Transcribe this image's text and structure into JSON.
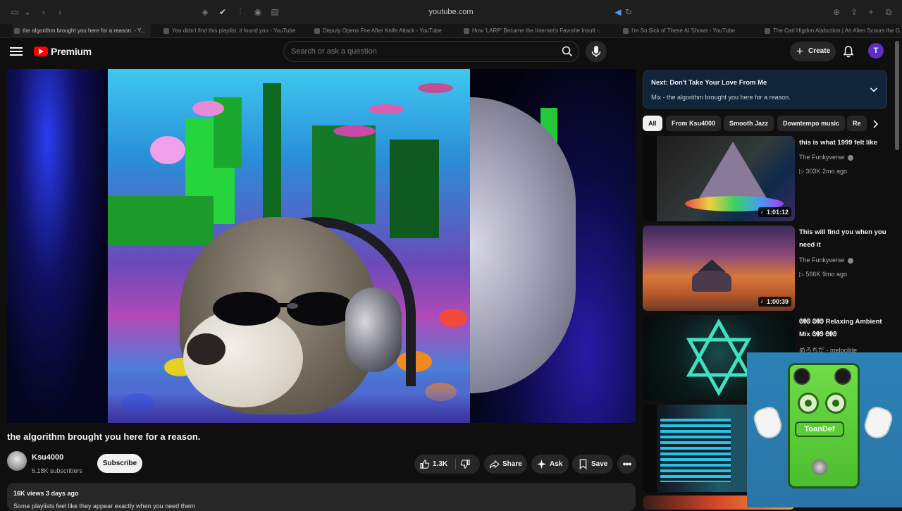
{
  "browser": {
    "url": "youtube.com",
    "tabs": [
      "the algorithm brought you here for a reason. - Y...",
      "You didn't find this playlist, it found you - YouTube",
      "Deputy Opens Fire After Knife Attack - YouTube",
      "How 'LARP' Became the Internet's Favorite Insult -...",
      "I'm So Sick of These AI Shows - YouTube",
      "The Carl Higdon Abduction | An Alien Scours the G..."
    ]
  },
  "masthead": {
    "logo_text": "Premium",
    "search_placeholder": "Search or ask a question",
    "create_label": "Create",
    "avatar_letter": "T"
  },
  "video": {
    "title": "the algorithm brought you here for a reason.",
    "channel": "Ksu4000",
    "subscribers": "6.18K subscribers",
    "subscribe_label": "Subscribe",
    "likes": "1.3K",
    "share_label": "Share",
    "ask_label": "Ask",
    "save_label": "Save",
    "meta": "16K views  3 days ago",
    "description": "Some playlists feel like they appear exactly when you need them"
  },
  "next_panel": {
    "title": "Next: Don't Take Your Love From Me",
    "subtitle": "Mix - the algorithm brought you here for a reason."
  },
  "chips": [
    "All",
    "From Ksu4000",
    "Smooth Jazz",
    "Downtempo music",
    "Re"
  ],
  "recommendations": [
    {
      "title": "this is what 1999 felt like",
      "channel": "The Funkyverse",
      "stats": "▷ 303K  2mo ago",
      "duration": "1:01:12"
    },
    {
      "title": "This will find you when you need it",
      "channel": "The Funkyverse",
      "stats": "▷ 566K  9mo ago",
      "duration": "1:00:39"
    },
    {
      "title": "ᘛᘚ ᘛᘚ Relaxing Ambient Mix ᘛᘚ ᘛᘚ",
      "channel": "めろちだ - melocilde",
      "stats": "",
      "duration": ""
    }
  ],
  "pip": {
    "pedal_label": "ToanDef"
  },
  "colors": {
    "youtube_red": "#ff0000",
    "avatar_purple": "#5c2fc2",
    "next_panel_bg": "#10243a",
    "pedal_green": "#5ccb38"
  }
}
